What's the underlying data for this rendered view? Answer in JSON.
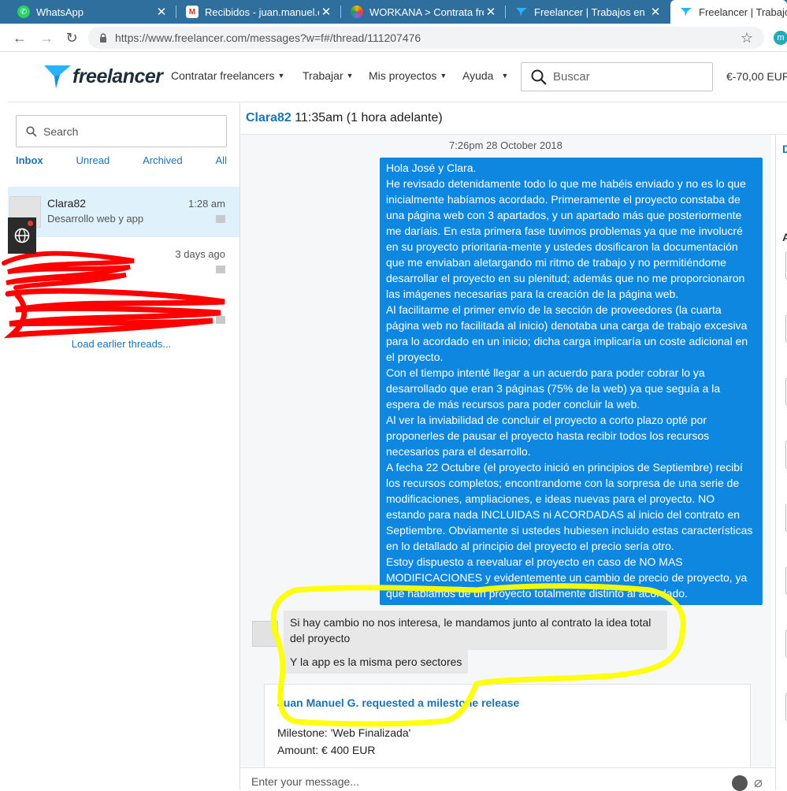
{
  "browser": {
    "tabs": [
      {
        "title": "WhatsApp",
        "icon": "whatsapp-icon",
        "color": "#25d366"
      },
      {
        "title": "Recibidos - juan.manuel.oje",
        "icon": "gmail-icon",
        "color": "#d93025"
      },
      {
        "title": "WORKANA > Contrata free",
        "icon": "workana-icon",
        "color": "#7b61ff"
      },
      {
        "title": "Freelancer | Trabajos en lín",
        "icon": "freelancer-icon",
        "color": "#29b2fe"
      },
      {
        "title": "Freelancer | Trabajos",
        "icon": "freelancer-icon",
        "color": "#29b2fe"
      }
    ],
    "url": "https://www.freelancer.com/messages?w=f#/thread/111207476",
    "profile_initial": "m"
  },
  "header": {
    "brand": "freelancer",
    "nav": [
      "Contratar freelancers",
      "Trabajar",
      "Mis proyectos",
      "Ayuda"
    ],
    "search_placeholder": "Buscar",
    "balance": "€-70,00  EUR"
  },
  "sidebar": {
    "search_placeholder": "Search",
    "filters": [
      "Inbox",
      "Unread",
      "Archived",
      "All"
    ],
    "threads": [
      {
        "name": "Clara82",
        "preview": "Desarrollo web y app",
        "time": "1:28 am"
      },
      {
        "name": "",
        "preview": "",
        "time": "3 days ago"
      },
      {
        "name": "",
        "preview": "",
        "time": ""
      }
    ],
    "load_earlier": "Load earlier threads..."
  },
  "conversation": {
    "user": "Clara82",
    "local_time": "11:35am (1 hora adelante)",
    "date": "7:26pm 28 October 2018",
    "outgoing_lines": [
      "Hola José y Clara.",
      "He revisado detenidamente todo lo que me habéis enviado y no es lo que inicialmente habíamos acordado. Primeramente el proyecto constaba de una página web con 3 apartados, y un apartado más que posteriormente me daríais. En esta primera fase tuvimos problemas ya que me involucré en su proyecto prioritaria-mente y ustedes dosificaron la documentación que me enviaban aletargando mi ritmo de trabajo y no permitiéndome desarrollar el proyecto en su plenitud; además que no me proporcionaron las imágenes necesarias para la creación de la página web.",
      "Al facilitarme el primer envío de la sección de proveedores (la cuarta página web no facilitada al inicio) denotaba una carga de trabajo excesiva para lo acordado en un inicio; dicha carga implicaría un coste adicional en el proyecto.",
      "Con el tiempo intenté llegar a un acuerdo para poder cobrar lo ya desarrollado que eran 3 páginas (75% de la web) ya que seguía a la espera de más recursos para poder concluir la web.",
      "Al ver la inviabilidad de concluir el proyecto a corto plazo opté por proponerles de pausar el proyecto hasta recibir todos los recursos necesarios para el desarrollo.",
      "A fecha 22 Octubre (el proyecto inició en principios de Septiembre) recibí los recursos completos; encontrandome con la sorpresa de una serie de modificaciones, ampliaciones, e ideas nuevas para el proyecto. NO estando para nada INCLUIDAS ni ACORDADAS al inicio del contrato en Septiembre. Obviamente si ustedes hubiesen incluido estas características en lo detallado al principio del proyecto el precio sería otro.",
      "Estoy dispuesto a reevaluar el proyecto en caso de NO MAS MODIFICACIONES y evidentemente un cambio de precio de proyecto, ya que hablamos de un proyecto totalmente distinto al acordado."
    ],
    "incoming": [
      "Si hay cambio no nos interesa, le mandamos junto al contrato la idea total del proyecto",
      "Y la app es la misma pero sectores"
    ],
    "milestone": {
      "title": "Juan Manuel G. requested a milestone release",
      "name_line": "Milestone: 'Web Finalizada'",
      "amount_line": "Amount: € 400 EUR"
    },
    "composer_placeholder": "Enter your message..."
  },
  "right_panel": {
    "letter_top": "D",
    "letter_mid": "A"
  },
  "colors": {
    "accent": "#1a73b8",
    "bubble": "#0d87e0",
    "highlight": "#ffff00",
    "scribble": "#ff0000",
    "tabbar": "#2f6f9e"
  }
}
